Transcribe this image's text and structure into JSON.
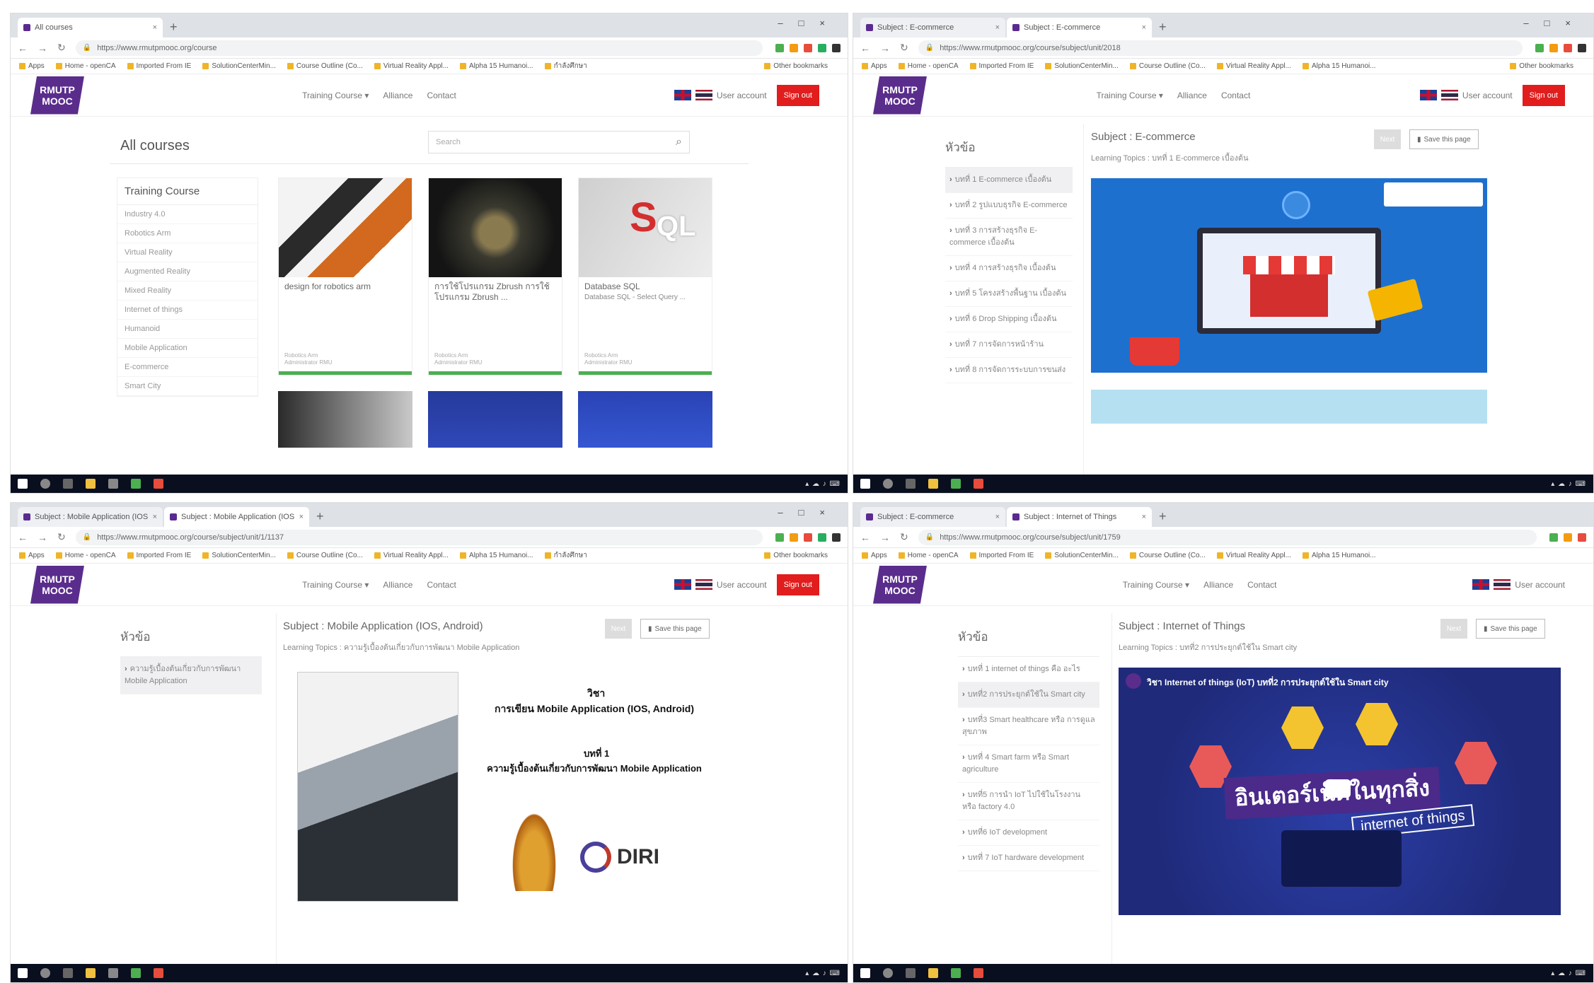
{
  "browser": {
    "url_p1": "https://www.rmutpmooc.org/course",
    "url_p2": "https://www.rmutpmooc.org/course/subject/unit/2018",
    "url_p3": "https://www.rmutpmooc.org/course/subject/unit/1/1137",
    "url_p4": "https://www.rmutpmooc.org/course/subject/unit/1759",
    "bookmarks": [
      "Apps",
      "Home - openCA",
      "Imported From IE",
      "SolutionCenterMin...",
      "Course Outline (Co...",
      "Virtual Reality Appl...",
      "Alpha 15 Humanoi...",
      "กำลังศึกษา"
    ],
    "other_bookmarks": "Other bookmarks"
  },
  "site": {
    "logo_line1": "RMUTP",
    "logo_line2": "MOOC",
    "nav": [
      "Training Course ▾",
      "Alliance",
      "Contact"
    ],
    "user_account": "User account",
    "sign_out": "Sign out"
  },
  "p1": {
    "page_title": "All courses",
    "search_placeholder": "Search",
    "categories_header": "Training Course",
    "categories": [
      "Industry 4.0",
      "Robotics Arm",
      "Virtual Reality",
      "Augmented Reality",
      "Mixed Reality",
      "Internet of things",
      "Humanoid",
      "Mobile Application",
      "E-commerce",
      "Smart City"
    ],
    "cards": [
      {
        "title": "design for robotics arm",
        "meta1": "Robotics Arm",
        "meta2": "Administrator RMU"
      },
      {
        "title": "การใช้โปรแกรม Zbrush การใช้โปรแกรม Zbrush ...",
        "meta1": "Robotics Arm",
        "meta2": "Administrator RMU"
      },
      {
        "title": "Database SQL",
        "desc": "Database SQL - Select Query ...",
        "meta1": "Robotics Arm",
        "meta2": "Administrator RMU"
      }
    ]
  },
  "p2": {
    "menu_header": "หัวข้อ",
    "menu": [
      "บทที่ 1 E-commerce เบื้องต้น",
      "บทที่ 2 รูปแบบธุรกิจ E-commerce",
      "บทที่ 3 การสร้างธุรกิจ E-commerce เบื้องต้น",
      "บทที่ 4 การสร้างธุรกิจ เบื้องต้น",
      "บทที่ 5 โครงสร้างพื้นฐาน เบื้องต้น",
      "บทที่ 6 Drop Shipping เบื้องต้น",
      "บทที่ 7 การจัดการหน้าร้าน",
      "บทที่ 8 การจัดการระบบการขนส่ง"
    ],
    "subject": "Subject : E-commerce",
    "topics": "Learning Topics : บทที่ 1 E-commerce เบื้องต้น",
    "next": "Next",
    "save": "Save this page"
  },
  "p3": {
    "menu_header": "หัวข้อ",
    "menu": [
      "ความรู้เบื้องต้นเกี่ยวกับการพัฒนา Mobile Application"
    ],
    "subject": "Subject : Mobile Application (IOS, Android)",
    "topics": "Learning Topics : ความรู้เบื้องต้นเกี่ยวกับการพัฒนา Mobile Application",
    "next": "Next",
    "save": "Save this page",
    "slide_label": "วิชา",
    "slide_course": "การเขียน Mobile Application (IOS, Android)",
    "slide_unit": "บทที่ 1",
    "slide_unit_title": "ความรู้เบื้องต้นเกี่ยวกับการพัฒนา Mobile Application",
    "diri": "DIRI"
  },
  "p4": {
    "menu_header": "หัวข้อ",
    "menu": [
      "บทที่ 1 internet of things คือ อะไร",
      "บทที่2 การประยุกต์ใช้ใน Smart city",
      "บทที่3 Smart healthcare หรือ การดูแลสุขภาพ",
      "บทที่ 4 Smart farm หรือ Smart agriculture",
      "บทที่5 การนำ IoT ไปใช้ในโรงงาน หรือ factory 4.0",
      "บทที่6 IoT development",
      "บทที่ 7 IoT hardware development"
    ],
    "subject": "Subject : Internet of Things",
    "topics": "Learning Topics : บทที่2 การประยุกต์ใช้ใน Smart city",
    "next": "Next",
    "save": "Save this page",
    "video_title": "วิชา Internet of things (IoT) บทที่2 การประยุกต์ใช้ใน Smart city",
    "video_big": "อินเตอร์เน็ตในทุกสิ่ง",
    "video_sub": "internet of things"
  },
  "colors": {
    "brand_purple": "#5a2d8c",
    "signout_red": "#e11d1d",
    "progress_green": "#4caf50",
    "ecom_blue": "#1e70cf",
    "iot_navy": "#1f2a7a"
  }
}
